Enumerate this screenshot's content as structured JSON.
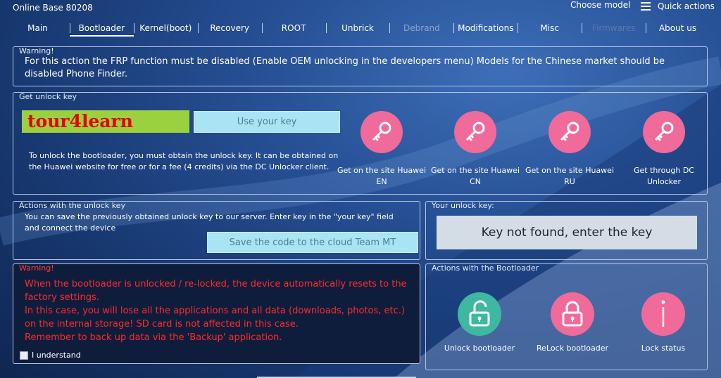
{
  "app": {
    "title": "Online Base 80208"
  },
  "header": {
    "choose_model": "Choose model",
    "quick_actions": "Quick actions"
  },
  "tabs": [
    {
      "label": "Main"
    },
    {
      "label": "Bootloader"
    },
    {
      "label": "Kernel(boot)"
    },
    {
      "label": "Recovery"
    },
    {
      "label": "ROOT"
    },
    {
      "label": "Unbrick"
    },
    {
      "label": "Debrand"
    },
    {
      "label": "Modifications"
    },
    {
      "label": "Misc"
    },
    {
      "label": "Firmwares"
    },
    {
      "label": "About us"
    }
  ],
  "warning": {
    "title": "Warning!",
    "text": "For this action the FRP function must be disabled (Enable OEM unlocking in the developers menu) Models for the Chinese market should be disabled Phone Finder."
  },
  "unlock_key": {
    "title": "Get unlock key",
    "key_value": "tour4learn",
    "use_key_button": "Use your key",
    "description": "To unlock the bootloader, you must obtain the unlock key. It can be obtained on the Huawei website for free or for a fee (4 credits) via the DC Unlocker client.",
    "sites": [
      {
        "label": "Get on the site Huawei EN"
      },
      {
        "label": "Get on the site Huawei CN"
      },
      {
        "label": "Get on the site Huawei RU"
      },
      {
        "label": "Get through DC Unlocker"
      }
    ]
  },
  "save_key": {
    "title": "Actions with the unlock key",
    "description": "You can save the previously obtained unlock key to our server. Enter key in the \"your key\" field and connect the device",
    "save_button": "Save the code to the cloud Team MT"
  },
  "your_key": {
    "title": "Your unlock key:",
    "status": "Key not found, enter the key"
  },
  "danger": {
    "title": "Warning!",
    "lines": [
      "When the bootloader is unlocked / re-locked, the device automatically resets to the factory settings.",
      "In this case, you will lose all the applications and all data (downloads, photos, etc.) on the internal storage! SD card is not affected in this case.",
      "Remember to back up data via the 'Backup' application."
    ],
    "checkbox_label": "I understand"
  },
  "bootloader_actions": {
    "title": "Actions with the Bootloader",
    "buttons": [
      {
        "label": "Unlock bootloader",
        "color": "#3fb8a2",
        "icon": "unlock-icon"
      },
      {
        "label": "ReLock bootloader",
        "color": "#f06a9a",
        "icon": "lock-icon"
      },
      {
        "label": "Lock status",
        "color": "#f06a9a",
        "icon": "info-icon"
      }
    ]
  },
  "colors": {
    "accent_pink": "#f06a9a",
    "accent_teal": "#3fb8a2",
    "button_cyan": "#a9e4f4",
    "key_green": "#9bd03e",
    "danger_red": "#ff2a2a"
  }
}
